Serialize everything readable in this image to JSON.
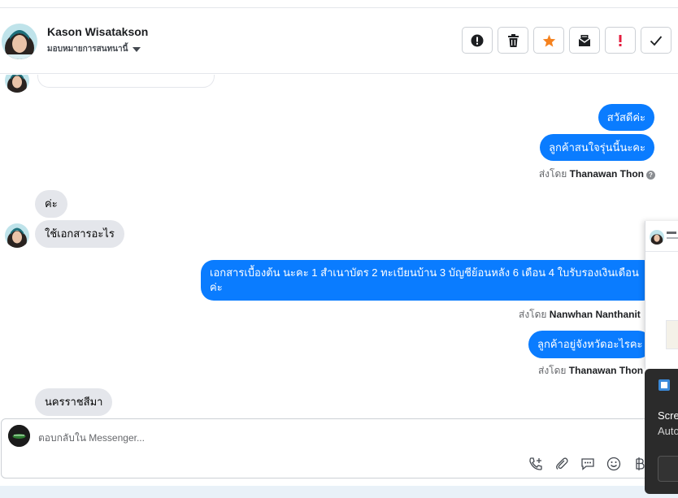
{
  "header": {
    "contact_name": "Kason Wisatakson",
    "assign_label": "มอบหมายการสนทนานี้",
    "toolbar": [
      {
        "name": "spam-alert-button",
        "icon": "alert-circle-icon"
      },
      {
        "name": "delete-button",
        "icon": "trash-icon"
      },
      {
        "name": "star-button",
        "icon": "star-icon"
      },
      {
        "name": "mark-unread-button",
        "icon": "envelope-icon"
      },
      {
        "name": "important-button",
        "icon": "exclamation-icon"
      },
      {
        "name": "done-button",
        "icon": "check-icon"
      }
    ]
  },
  "messages": {
    "out1": "สวัสดีค่ะ",
    "out2": "ลูกค้าสนใจรุ่นนี้นะคะ",
    "sent_by_1_prefix": "ส่งโดย",
    "sent_by_1_name": "Thanawan Thon",
    "in1": "ค่ะ",
    "in2": "ใช้เอกสารอะไร",
    "out3": "เอกสารเบื้องต้น นะคะ 1 สำเนาบัตร 2 ทะเบียนบ้าน 3 บัญชีย้อนหลัง 6 เดือน 4 ใบรับรองเงินเดือนค่ะ",
    "sent_by_2_prefix": "ส่งโดย",
    "sent_by_2_name": "Nanwhan Nanthanit",
    "out4": "ลูกค้าอยู่จังหวัดอะไรคะ",
    "sent_by_3_prefix": "ส่งโดย",
    "sent_by_3_name": "Thanawan Thon",
    "in3": "นครราชสีมา"
  },
  "composer": {
    "placeholder": "ตอบกลับใน Messenger..."
  },
  "overlay": {
    "line1": "Scre",
    "line2": "Auto"
  },
  "colors": {
    "outgoing_bubble": "#0a7cff",
    "incoming_bubble": "#e4e6eb",
    "star": "#f5821f",
    "important": "#e41e3f"
  }
}
